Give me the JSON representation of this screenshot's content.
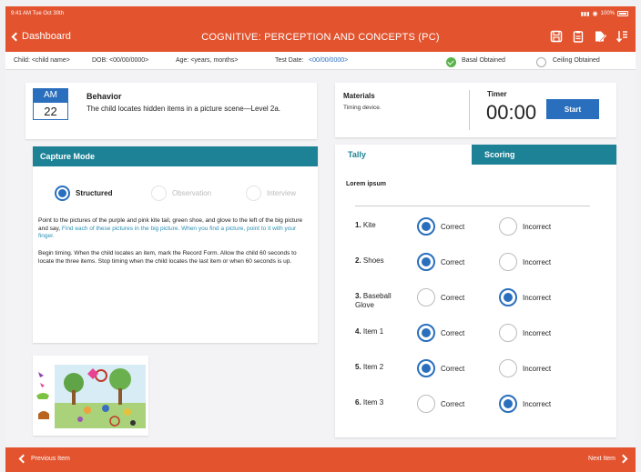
{
  "status": {
    "time": "9:41 AM  Tue Oct 30th",
    "battery": "100%"
  },
  "nav": {
    "back_label": "Dashboard",
    "title": "COGNITIVE: PERCEPTION AND CONCEPTS (PC)",
    "icons": [
      "save-icon",
      "clipboard-icon",
      "edit-record-icon",
      "download-icon"
    ]
  },
  "info": {
    "child": "Child: <child name>",
    "dob": "DOB: <00/00/0000>",
    "age": "Age: <years, months>",
    "test_date_label": "Test Date:",
    "test_date_value": "<00/00/0000>",
    "basal": "Basal Obtained",
    "ceiling": "Ceiling Obtained"
  },
  "behavior": {
    "meridiem": "AM",
    "day": "22",
    "title": "Behavior",
    "text": "The child locates hidden items in a picture scene—Level 2a."
  },
  "materials": {
    "title": "Materials",
    "text": "Timing device."
  },
  "timer": {
    "label": "Timer",
    "value": "00:00",
    "start_label": "Start"
  },
  "capture": {
    "title": "Capture Mode",
    "modes": [
      {
        "label": "Structured",
        "selected": true
      },
      {
        "label": "Observation",
        "selected": false
      },
      {
        "label": "Interview",
        "selected": false
      }
    ],
    "p1_plain": "Point to the pictures of the purple and pink kite tail, green shoe, and glove to the left of the big picture and say, ",
    "p1_highlight": "Find each of these pictures in the big picture. When you find a picture, point to it with your finger.",
    "p2": "Begin timing. When the child locates an item, mark the Record Form. Allow the child 60 seconds to locate the three items. Stop timing when the child locates the last item or when 60 seconds is up."
  },
  "tally": {
    "tab_tally": "Tally",
    "tab_scoring": "Scoring",
    "heading": "Lorem ipsum",
    "correct_label": "Correct",
    "incorrect_label": "Incorrect",
    "items": [
      {
        "num": "1.",
        "name": "Kite",
        "answer": "correct"
      },
      {
        "num": "2.",
        "name": "Shoes",
        "answer": "correct"
      },
      {
        "num": "3.",
        "name": "Baseball Glove",
        "answer": "incorrect"
      },
      {
        "num": "4.",
        "name": "Item 1",
        "answer": "correct"
      },
      {
        "num": "5.",
        "name": "Item 2",
        "answer": "correct"
      },
      {
        "num": "6.",
        "name": "Item 3",
        "answer": "incorrect"
      }
    ]
  },
  "footer": {
    "prev_label": "Previous Item",
    "next_label": "Next Item"
  },
  "colors": {
    "brand": "#e2532e",
    "teal": "#1d8296",
    "blue": "#2a6fbd",
    "green": "#59b24b"
  }
}
